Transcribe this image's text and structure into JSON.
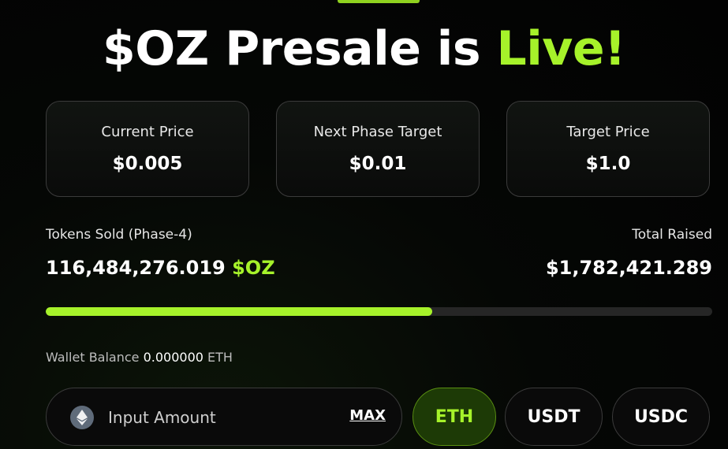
{
  "header": {
    "title_main": "$OZ Presale is",
    "title_accent": "Live!"
  },
  "stats": [
    {
      "label": "Current Price",
      "value": "$0.005"
    },
    {
      "label": "Next Phase Target",
      "value": "$0.01"
    },
    {
      "label": "Target Price",
      "value": "$1.0"
    }
  ],
  "progress": {
    "sold_label": "Tokens Sold (Phase-4)",
    "sold_amount": "116,484,276.019",
    "sold_ticker": "$OZ",
    "raised_label": "Total Raised",
    "raised_amount": "$1,782,421.289",
    "fill_percent": 58
  },
  "wallet": {
    "label": "Wallet Balance",
    "amount": "0.000000",
    "unit": "ETH"
  },
  "purchase": {
    "placeholder": "Input Amount",
    "max_label": "MAX",
    "input_icon": "ethereum-icon",
    "currencies": [
      "ETH",
      "USDT",
      "USDC"
    ],
    "selected_currency": "ETH"
  },
  "colors": {
    "accent": "#a6f22a",
    "background": "#030303",
    "card_border": "#3b3b3b"
  }
}
